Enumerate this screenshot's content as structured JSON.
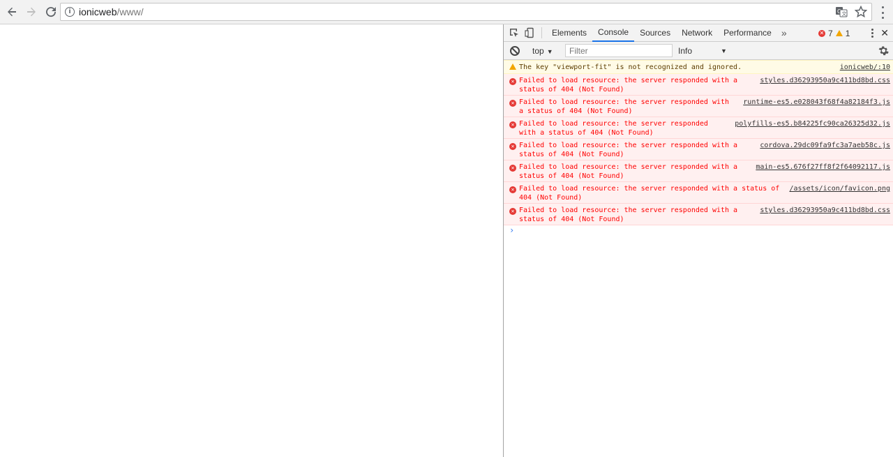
{
  "browser": {
    "url_host": "ionicweb",
    "url_path": "/www/",
    "icons": [
      "back-arrow-icon",
      "forward-arrow-icon",
      "reload-icon",
      "info-icon",
      "translate-icon",
      "star-icon",
      "menu-dots-icon"
    ]
  },
  "devtools": {
    "tabs": [
      {
        "label": "Elements",
        "active": false
      },
      {
        "label": "Console",
        "active": true
      },
      {
        "label": "Sources",
        "active": false
      },
      {
        "label": "Network",
        "active": false
      },
      {
        "label": "Performance",
        "active": false
      }
    ],
    "more_tabs": "»",
    "error_count": "7",
    "warning_count": "1",
    "context": "top",
    "filter_placeholder": "Filter",
    "level": "Info",
    "close": "✕"
  },
  "console": {
    "warning": {
      "text": "The key \"viewport-fit\" is not recognized and ignored.",
      "source": "ionicweb/:10"
    },
    "errors": [
      {
        "text": "Failed to load resource: the server responded with a status of 404 (Not Found)",
        "source": "styles.d36293950a9c411bd8bd.css"
      },
      {
        "text": "Failed to load resource: the server responded with a status of 404 (Not Found)",
        "source": "runtime-es5.e028043f68f4a82184f3.js"
      },
      {
        "text": "Failed to load resource: the server responded with a status of 404 (Not Found)",
        "source": "polyfills-es5.b84225fc90ca26325d32.js"
      },
      {
        "text": "Failed to load resource: the server responded with a status of 404 (Not Found)",
        "source": "cordova.29dc09fa9fc3a7aeb58c.js"
      },
      {
        "text": "Failed to load resource: the server responded with a status of 404 (Not Found)",
        "source": "main-es5.676f27ff8f2f64092117.js"
      },
      {
        "text": "Failed to load resource: the server responded with a status of 404 (Not Found)",
        "source": "/assets/icon/favicon.png"
      },
      {
        "text": "Failed to load resource: the server responded with a status of 404 (Not Found)",
        "source": "styles.d36293950a9c411bd8bd.css"
      }
    ],
    "prompt": "›"
  },
  "colors": {
    "error": "#ff0000",
    "warning_bg": "#fffbe6",
    "error_bg": "#fff0f0",
    "active_tab": "#1a73e8"
  }
}
